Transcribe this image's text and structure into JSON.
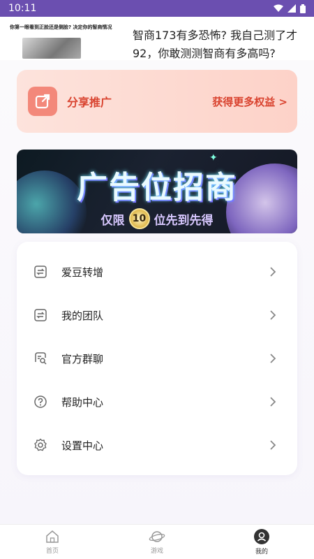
{
  "status_bar": {
    "time": "10:11"
  },
  "ad": {
    "thumb_caption": "你第一眼看到正脸还是侧脸? 决定你的智商情况",
    "headline": "智商173有多恐怖? 我自己测了才92，你敢测测智商有多高吗?"
  },
  "share": {
    "label": "分享推广",
    "more": "获得更多权益 >"
  },
  "banner": {
    "title": "广告位招商",
    "sub_left": "仅限",
    "badge": "10",
    "sub_right": "位先到先得"
  },
  "menu": {
    "items": [
      {
        "label": "爱豆转增",
        "icon": "transfer-icon"
      },
      {
        "label": "我的团队",
        "icon": "team-icon"
      },
      {
        "label": "官方群聊",
        "icon": "group-chat-icon"
      },
      {
        "label": "帮助中心",
        "icon": "help-icon"
      },
      {
        "label": "设置中心",
        "icon": "settings-icon"
      }
    ]
  },
  "tabs": [
    {
      "label": "首页",
      "icon": "home-icon",
      "active": false
    },
    {
      "label": "游戏",
      "icon": "game-planet-icon",
      "active": false
    },
    {
      "label": "我的",
      "icon": "profile-icon",
      "active": true
    }
  ],
  "colors": {
    "status_bar": "#6b4fb0",
    "accent_red": "#d9432f",
    "share_icon_bg": "#f3887a"
  }
}
